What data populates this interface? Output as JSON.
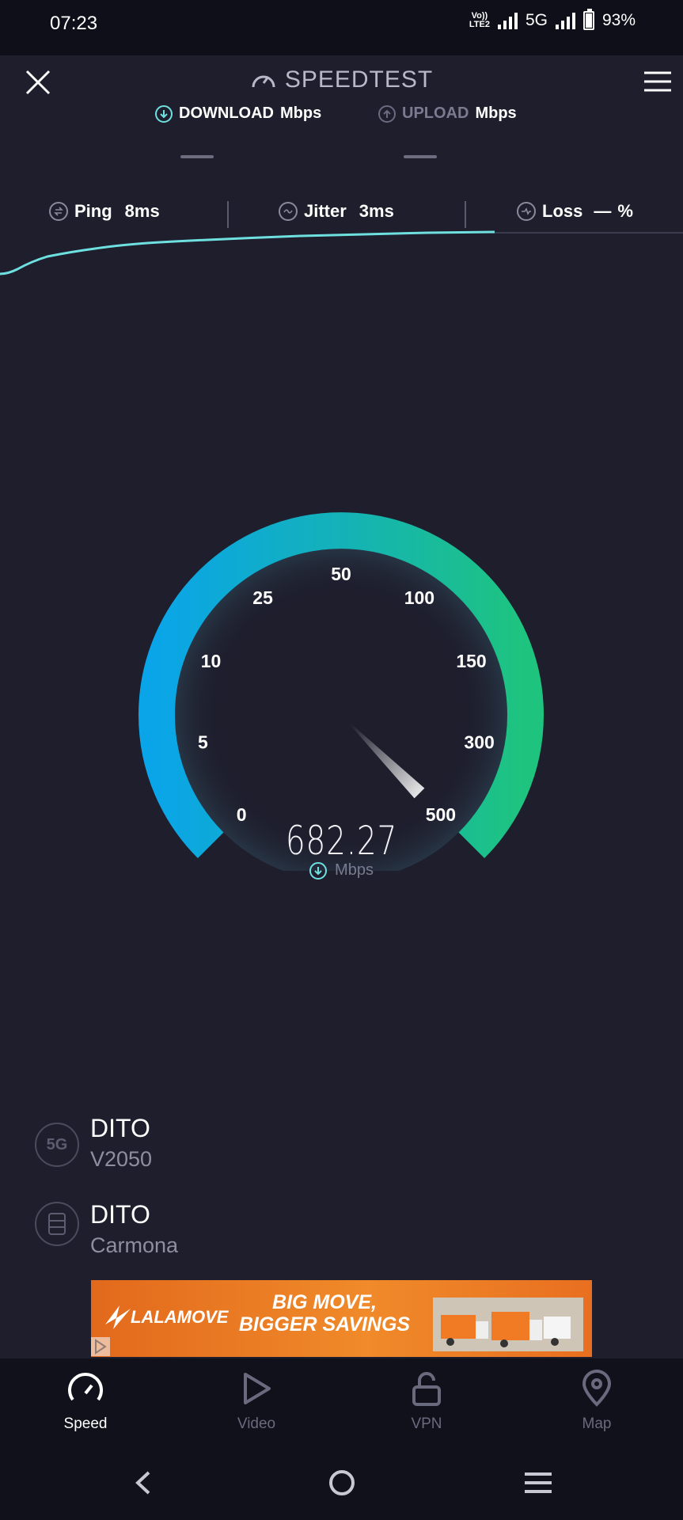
{
  "status_bar": {
    "time": "07:23",
    "volte_top": "Vo))",
    "volte_bottom": "LTE2",
    "network": "5G",
    "battery": "93%"
  },
  "header": {
    "title": "SPEEDTEST"
  },
  "download": {
    "label": "DOWNLOAD",
    "unit": "Mbps"
  },
  "upload": {
    "label": "UPLOAD",
    "unit": "Mbps"
  },
  "ping": {
    "label": "Ping",
    "value": "8ms"
  },
  "jitter": {
    "label": "Jitter",
    "value": "3ms"
  },
  "loss": {
    "label": "Loss",
    "value": "—",
    "unit": "%"
  },
  "gauge": {
    "scale_labels": [
      "0",
      "5",
      "10",
      "25",
      "50",
      "100",
      "150",
      "300",
      "500"
    ],
    "value": "682.27",
    "unit": "Mbps"
  },
  "connection": {
    "network_badge": "5G",
    "provider": "DITO",
    "device": "V2050",
    "server_provider": "DITO",
    "server_location": "Carmona"
  },
  "ad": {
    "brand": "LALAMOVE",
    "headline_1": "BIG MOVE,",
    "headline_2": "BIGGER SAVINGS"
  },
  "nav": {
    "items": [
      {
        "label": "Speed"
      },
      {
        "label": "Video"
      },
      {
        "label": "VPN"
      },
      {
        "label": "Map"
      }
    ]
  },
  "colors": {
    "accent": "#6ee0e0",
    "gauge_start": "#0aa5e8",
    "gauge_end": "#1ec47e",
    "background": "#1e1e2d"
  }
}
